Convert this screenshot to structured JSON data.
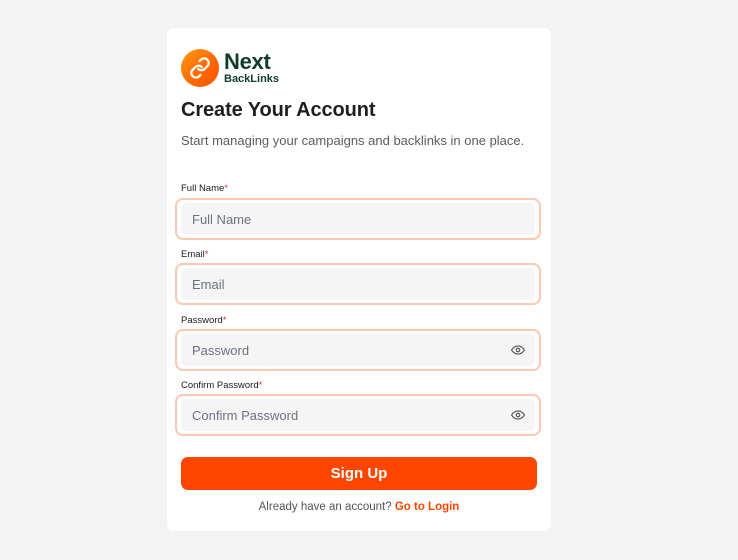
{
  "brand": {
    "name": "Next",
    "subname": "BackLinks",
    "icon": "link-icon",
    "accent": "#ff4500"
  },
  "heading": "Create Your Account",
  "subtitle": "Start managing your campaigns and backlinks in one place.",
  "form": {
    "required_marker": "*",
    "full_name": {
      "label": "Full Name",
      "placeholder": "Full Name",
      "value": ""
    },
    "email": {
      "label": "Email",
      "placeholder": "Email",
      "value": ""
    },
    "password": {
      "label": "Password",
      "placeholder": "Password",
      "value": "",
      "toggle_icon": "eye-icon"
    },
    "confirm_password": {
      "label": "Confirm Password",
      "placeholder": "Confirm Password",
      "value": "",
      "toggle_icon": "eye-icon"
    },
    "submit_label": "Sign Up"
  },
  "footer": {
    "text": "Already have an account?",
    "link_label": "Go to Login"
  },
  "colors": {
    "accent": "#ff4500",
    "field_border": "#fdc7b0",
    "field_bg": "#f5f5f5",
    "brand_text": "#0f3d2a"
  }
}
